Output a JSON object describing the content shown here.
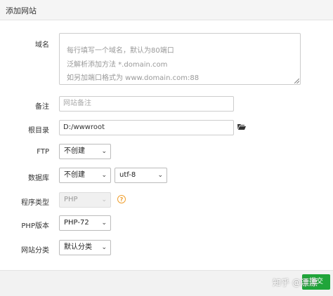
{
  "dialog": {
    "title": "添加网站"
  },
  "form": {
    "domain": {
      "label": "域名",
      "placeholder_lines": [
        "每行填写一个域名，默认为80端口",
        "泛解析添加方法 *.domain.com",
        "如另加端口格式为 www.domain.com:88"
      ]
    },
    "note": {
      "label": "备注",
      "placeholder": "网站备注"
    },
    "root": {
      "label": "根目录",
      "value": "D:/wwwroot"
    },
    "ftp": {
      "label": "FTP",
      "selected": "不创建"
    },
    "database": {
      "label": "数据库",
      "selected": "不创建",
      "charset": "utf-8"
    },
    "program_type": {
      "label": "程序类型",
      "selected": "PHP"
    },
    "php_version": {
      "label": "PHP版本",
      "selected": "PHP-72"
    },
    "category": {
      "label": "网站分类",
      "selected": "默认分类"
    }
  },
  "footer": {
    "submit_label": "提交",
    "watermark": "知乎 @漂漂"
  },
  "colors": {
    "accent": "#20a53a",
    "help": "#f0a030",
    "folder": "#333333"
  }
}
